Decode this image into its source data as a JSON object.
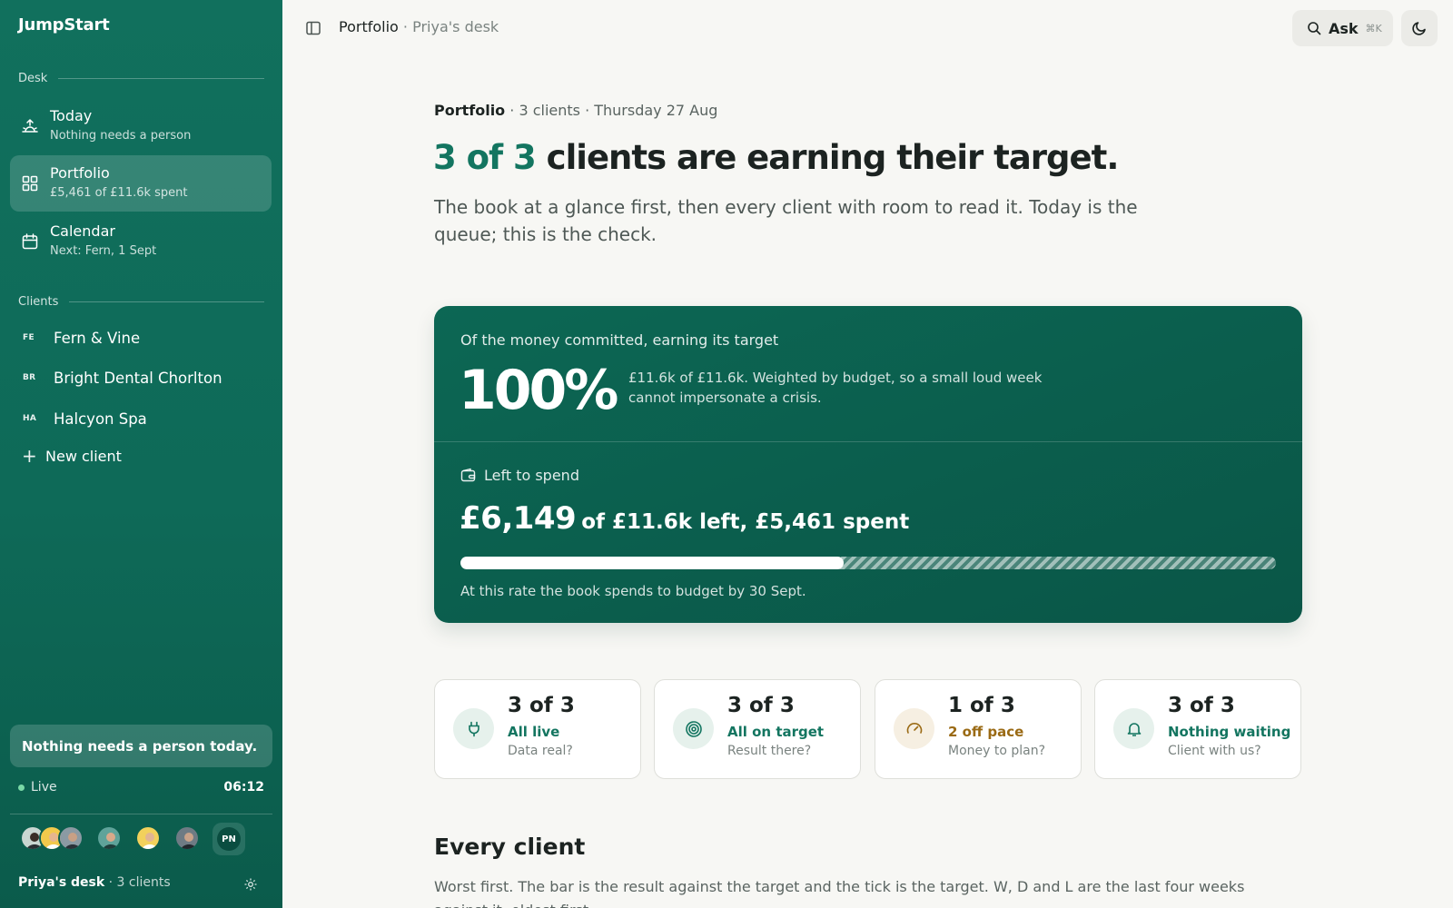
{
  "app": {
    "name": "JumpStart"
  },
  "sidebar": {
    "desk_label": "Desk",
    "nav": [
      {
        "title": "Today",
        "subtitle": "Nothing needs a person",
        "icon": "sunrise-icon"
      },
      {
        "title": "Portfolio",
        "subtitle": "£5,461 of £11.6k spent",
        "icon": "grid-icon"
      },
      {
        "title": "Calendar",
        "subtitle": "Next: Fern, 1 Sept",
        "icon": "calendar-icon"
      }
    ],
    "clients_label": "Clients",
    "clients": [
      {
        "abbr": "FE",
        "name": "Fern & Vine"
      },
      {
        "abbr": "BR",
        "name": "Bright Dental Chorlton"
      },
      {
        "abbr": "HA",
        "name": "Halcyon Spa"
      }
    ],
    "new_client": "New client",
    "notice": "Nothing needs a person today.",
    "live_label": "Live",
    "time": "06:12",
    "current_user_initials": "PN",
    "desk_name": "Priya's desk",
    "desk_clients": "· 3 clients"
  },
  "topbar": {
    "title": "Portfolio",
    "subtitle": "· Priya's desk",
    "ask_label": "Ask",
    "ask_shortcut": "⌘K"
  },
  "main": {
    "meta_title": "Portfolio",
    "meta_rest": "· 3 clients · Thursday 27 Aug",
    "headline_accent": "3 of 3",
    "headline_rest": " clients are earning their target.",
    "lede": "The book at a glance first, then every client with room to read it. Today is the queue; this is the check.",
    "hero": {
      "kicker": "Of the money committed, earning its target",
      "big": "100%",
      "note": "£11.6k of £11.6k. Weighted by budget, so a small loud week cannot impersonate a crisis.",
      "left_label": "Left to spend",
      "amount": "£6,149",
      "amount_rest": "of £11.6k left, £5,461 spent",
      "spent_fraction": 0.47,
      "footnote": "At this rate the book spends to budget by 30 Sept."
    },
    "cards": [
      {
        "value": "3 of 3",
        "status": "All live",
        "question": "Data real?",
        "icon": "plug-icon",
        "status_color": "#137560",
        "icon_bg": "#e6f1ec"
      },
      {
        "value": "3 of 3",
        "status": "All on target",
        "question": "Result there?",
        "icon": "target-icon",
        "status_color": "#137560",
        "icon_bg": "#e6f1ec"
      },
      {
        "value": "1 of 3",
        "status": "2 off pace",
        "question": "Money to plan?",
        "icon": "gauge-icon",
        "status_color": "#9a6a14",
        "icon_bg": "#f6efe2"
      },
      {
        "value": "3 of 3",
        "status": "Nothing waiting",
        "question": "Client with us?",
        "icon": "bell-icon",
        "status_color": "#137560",
        "icon_bg": "#e6f1ec"
      }
    ],
    "every_title": "Every client",
    "every_desc": "Worst first. The bar is the result against the target and the tick is the target. W, D and L are the last four weeks against it, oldest first."
  }
}
